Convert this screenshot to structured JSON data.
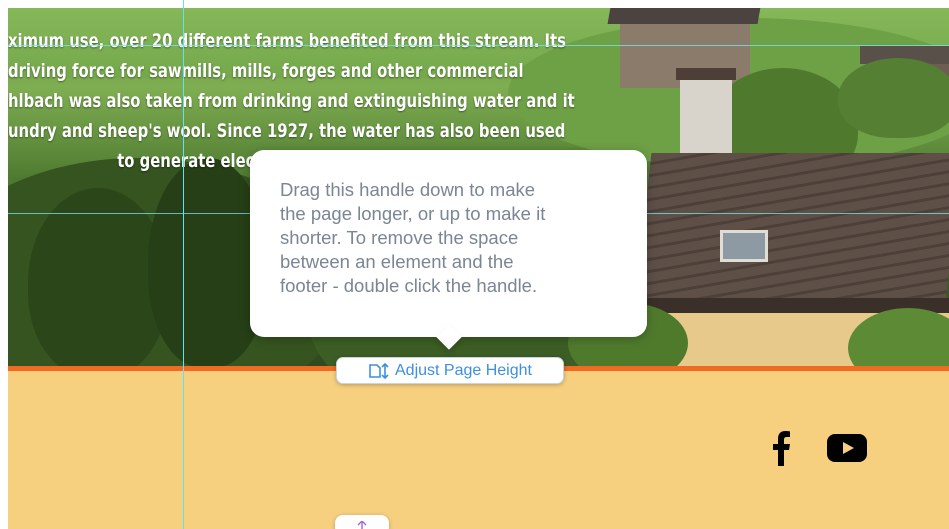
{
  "hero": {
    "paragraph_lines": [
      "ximum use, over 20 different farms benefited from this stream. Its",
      "driving force for sawmills, mills, forges and other commercial",
      "hlbach was also taken from drinking and extinguishing water and it",
      "undry and sheep's wool. Since 1927, the water has also been used",
      "to generate electricity."
    ]
  },
  "tooltip": {
    "text": "Drag this handle down to make\nthe page longer, or up to make it\nshorter. To remove the space\nbetween an element and the\nfooter - double click the handle."
  },
  "adjust_handle": {
    "label": "Adjust Page Height",
    "icon": "page-height-icon"
  },
  "footer": {
    "background": "#f6cf7f",
    "border_color": "#f06a22",
    "social_icons": [
      "facebook-icon",
      "youtube-icon"
    ]
  },
  "colors": {
    "guide": "#5fe3ee",
    "handle_text": "#3d8fe0",
    "tooltip_text": "#7b8593"
  }
}
